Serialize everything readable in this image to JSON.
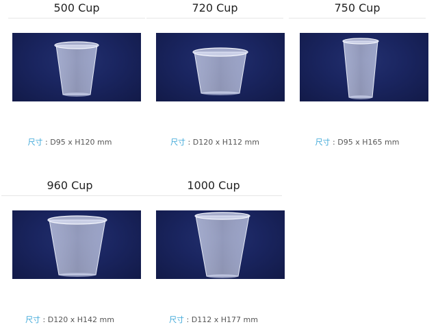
{
  "products": [
    {
      "title": "500 Cup",
      "spec_label": "尺寸",
      "spec_sep": " : ",
      "spec_value": "D95 x H120 mm",
      "cup": "cup-icon"
    },
    {
      "title": "720 Cup",
      "spec_label": "尺寸",
      "spec_sep": " : ",
      "spec_value": "D120 x H112 mm",
      "cup": "cup-icon"
    },
    {
      "title": "750 Cup",
      "spec_label": "尺寸",
      "spec_sep": " : ",
      "spec_value": "D95 x H165 mm",
      "cup": "cup-icon"
    },
    {
      "title": "960 Cup",
      "spec_label": "尺寸",
      "spec_sep": " : ",
      "spec_value": "D120 x H142 mm",
      "cup": "cup-icon"
    },
    {
      "title": "1000 Cup",
      "spec_label": "尺寸",
      "spec_sep": " : ",
      "spec_value": "D112 x H177 mm",
      "cup": "cup-icon"
    }
  ],
  "colors": {
    "photo_background": "#1a2560",
    "spec_label": "#3aa6d8",
    "spec_value": "#555555",
    "title": "#222222"
  }
}
